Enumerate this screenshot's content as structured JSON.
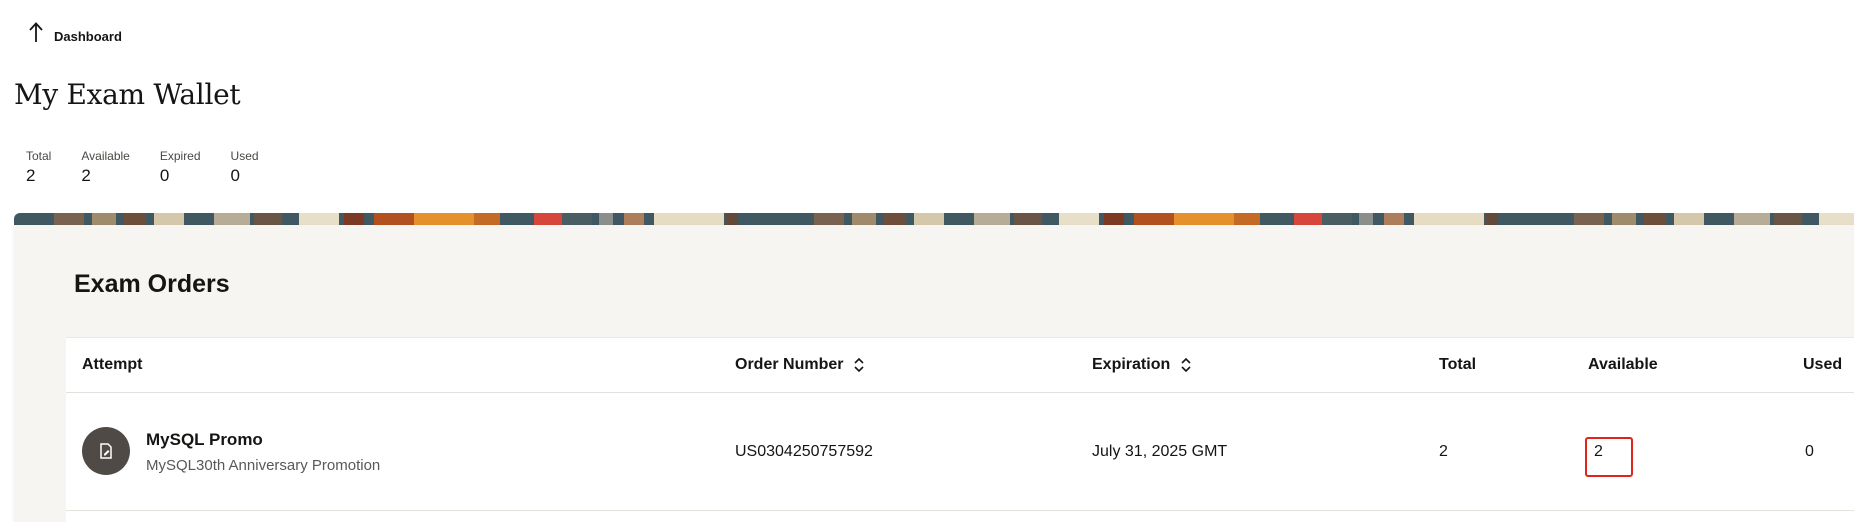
{
  "nav": {
    "back_label": "Dashboard"
  },
  "page": {
    "title": "My Exam Wallet"
  },
  "stats": [
    {
      "label": "Total",
      "value": "2"
    },
    {
      "label": "Available",
      "value": "2"
    },
    {
      "label": "Expired",
      "value": "0"
    },
    {
      "label": "Used",
      "value": "0"
    }
  ],
  "section": {
    "title": "Exam Orders"
  },
  "table": {
    "columns": [
      {
        "label": "Attempt",
        "sortable": false
      },
      {
        "label": "Order Number",
        "sortable": true
      },
      {
        "label": "Expiration",
        "sortable": true
      },
      {
        "label": "Total",
        "sortable": false
      },
      {
        "label": "Available",
        "sortable": false
      },
      {
        "label": "Used",
        "sortable": false
      }
    ],
    "rows": [
      {
        "attempt_name": "MySQL Promo",
        "attempt_sub": "MySQL30th Anniversary Promotion",
        "order_number": "US0304250757592",
        "expiration": "July 31, 2025 GMT",
        "total": "2",
        "available": "2",
        "used": "0",
        "icon": "exam-voucher-icon"
      }
    ]
  },
  "colors": {
    "highlight": "#e0241c",
    "card_background": "#f7f5f2",
    "avatar": "#4f4a45"
  }
}
